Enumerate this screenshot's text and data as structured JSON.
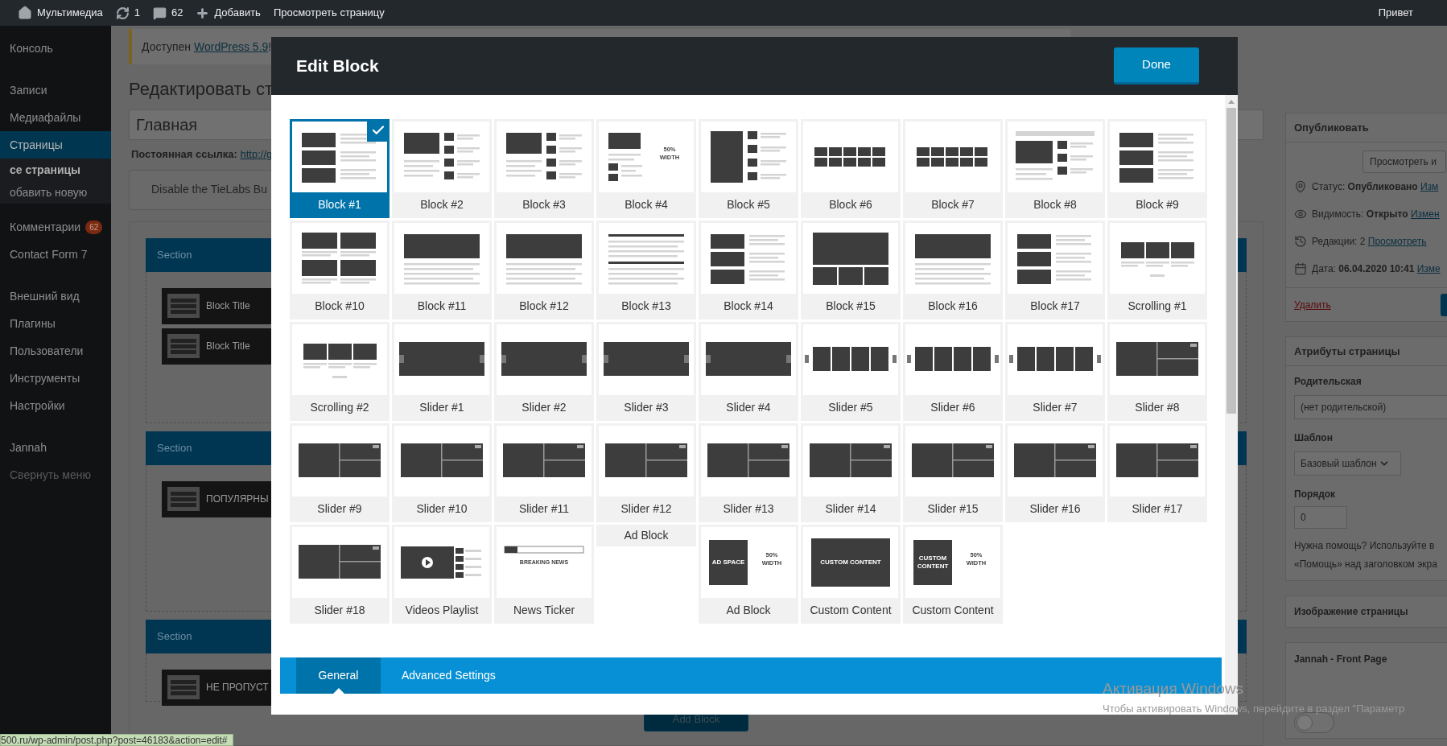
{
  "admin_bar": {
    "site": "Мультимедиа",
    "updates": "1",
    "comments": "62",
    "add": "Добавить",
    "view": "Просмотреть страницу",
    "greeting": "Привет"
  },
  "sidebar": {
    "items": [
      {
        "label": "Консоль",
        "selected": false,
        "kind": "item"
      },
      {
        "label": "Записи",
        "selected": false,
        "kind": "item"
      },
      {
        "label": "Медиафайлы",
        "selected": false,
        "kind": "item"
      },
      {
        "label": "Страницы",
        "selected": true,
        "kind": "item"
      },
      {
        "label": "се страницы",
        "selected": true,
        "kind": "sub"
      },
      {
        "label": "обавить новую",
        "selected": false,
        "kind": "sub"
      },
      {
        "label": "Комментарии",
        "selected": false,
        "kind": "item",
        "badge": "62"
      },
      {
        "label": "Contact Form 7",
        "selected": false,
        "kind": "item"
      },
      {
        "label": "Внешний вид",
        "selected": false,
        "kind": "item"
      },
      {
        "label": "Плагины",
        "selected": false,
        "kind": "item"
      },
      {
        "label": "Пользователи",
        "selected": false,
        "kind": "item"
      },
      {
        "label": "Инструменты",
        "selected": false,
        "kind": "item"
      },
      {
        "label": "Настройки",
        "selected": false,
        "kind": "item"
      },
      {
        "label": "Jannah",
        "selected": false,
        "kind": "item"
      },
      {
        "label": "Свернуть меню",
        "selected": false,
        "kind": "collapse"
      }
    ]
  },
  "notice": {
    "text": "Доступен ",
    "link": "WordPress 5.9",
    "end": "!"
  },
  "heading": "Редактировать ст",
  "title_field": {
    "value": "Главная"
  },
  "permalink": {
    "label": "Постоянная ссылка: ",
    "link": "http://g"
  },
  "builder_toggle": "Disable the TieLabs Bu",
  "sections": [
    {
      "title": "Section",
      "blocks": [
        "Block Title",
        "Block Title"
      ]
    },
    {
      "title": "Section",
      "blocks": [
        "ПОПУЛЯРНЫ"
      ]
    },
    {
      "title": "Section",
      "blocks": [
        "НЕ ПРОПУСТ"
      ]
    }
  ],
  "add_block": "Add Block",
  "modal": {
    "title": "Edit Block",
    "done": "Done",
    "tiles": [
      {
        "label": "Block #1",
        "selected": true,
        "kind": "rows"
      },
      {
        "label": "Block #2",
        "selected": false,
        "kind": "feature"
      },
      {
        "label": "Block #3",
        "selected": false,
        "kind": "feature"
      },
      {
        "label": "Block #4",
        "selected": false,
        "kind": "half",
        "side_text": [
          "50%",
          "WIDTH"
        ]
      },
      {
        "label": "Block #5",
        "selected": false,
        "kind": "tall"
      },
      {
        "label": "Block #6",
        "selected": false,
        "kind": "grid"
      },
      {
        "label": "Block #7",
        "selected": false,
        "kind": "grid"
      },
      {
        "label": "Block #8",
        "selected": false,
        "kind": "tabs"
      },
      {
        "label": "Block #9",
        "selected": false,
        "kind": "rows"
      },
      {
        "label": "Block #10",
        "selected": false,
        "kind": "two"
      },
      {
        "label": "Block #11",
        "selected": false,
        "kind": "wide"
      },
      {
        "label": "Block #12",
        "selected": false,
        "kind": "wide"
      },
      {
        "label": "Block #13",
        "selected": false,
        "kind": "lines"
      },
      {
        "label": "Block #14",
        "selected": false,
        "kind": "rows"
      },
      {
        "label": "Block #15",
        "selected": false,
        "kind": "big3"
      },
      {
        "label": "Block #16",
        "selected": false,
        "kind": "wide"
      },
      {
        "label": "Block #17",
        "selected": false,
        "kind": "rows"
      },
      {
        "label": "Scrolling #1",
        "selected": false,
        "kind": "scroll"
      },
      {
        "label": "Scrolling #2",
        "selected": false,
        "kind": "scroll"
      },
      {
        "label": "Slider #1",
        "selected": false,
        "kind": "slider"
      },
      {
        "label": "Slider #2",
        "selected": false,
        "kind": "slider"
      },
      {
        "label": "Slider #3",
        "selected": false,
        "kind": "slider"
      },
      {
        "label": "Slider #4",
        "selected": false,
        "kind": "slider"
      },
      {
        "label": "Slider #5",
        "selected": false,
        "kind": "carousel"
      },
      {
        "label": "Slider #6",
        "selected": false,
        "kind": "carousel"
      },
      {
        "label": "Slider #7",
        "selected": false,
        "kind": "carousel"
      },
      {
        "label": "Slider #8",
        "selected": false,
        "kind": "mosaic"
      },
      {
        "label": "Slider #9",
        "selected": false,
        "kind": "mosaic"
      },
      {
        "label": "Slider #10",
        "selected": false,
        "kind": "mosaic"
      },
      {
        "label": "Slider #11",
        "selected": false,
        "kind": "mosaic"
      },
      {
        "label": "Slider #12",
        "selected": false,
        "kind": "mosaic"
      },
      {
        "label": "Slider #13",
        "selected": false,
        "kind": "mosaic"
      },
      {
        "label": "Slider #14",
        "selected": false,
        "kind": "mosaic"
      },
      {
        "label": "Slider #15",
        "selected": false,
        "kind": "mosaic"
      },
      {
        "label": "Slider #16",
        "selected": false,
        "kind": "mosaic"
      },
      {
        "label": "Slider #17",
        "selected": false,
        "kind": "mosaic"
      },
      {
        "label": "Slider #18",
        "selected": false,
        "kind": "mosaic"
      },
      {
        "label": "Videos Playlist",
        "selected": false,
        "kind": "video"
      },
      {
        "label": "News Ticker",
        "selected": false,
        "kind": "ticker",
        "side_text": [
          "BREAKING NEWS"
        ]
      },
      {
        "label": "Ad Block",
        "selected": false,
        "kind": "label"
      },
      {
        "label": "Ad Block",
        "selected": false,
        "kind": "ad",
        "box_text": [
          "AD SPACE"
        ],
        "side_text": [
          "50%",
          "WIDTH"
        ]
      },
      {
        "label": "Custom Content",
        "selected": false,
        "kind": "custom",
        "box_text": [
          "CUSTOM CONTENT"
        ]
      },
      {
        "label": "Custom Content",
        "selected": false,
        "kind": "ad",
        "box_text": [
          "CUSTOM",
          "CONTENT"
        ],
        "side_text": [
          "50%",
          "WIDTH"
        ]
      }
    ],
    "tabs": [
      {
        "label": "General",
        "selected": true
      },
      {
        "label": "Advanced Settings",
        "selected": false
      }
    ]
  },
  "publish": {
    "title": "Опубликовать",
    "preview": "Просмотреть и",
    "rows": [
      {
        "kind": "status",
        "label": "Статус: ",
        "value": "Опубликовано",
        "link": "Изм"
      },
      {
        "kind": "visibility",
        "label": "Видимость: ",
        "value": "Открыто",
        "link": "Измен"
      },
      {
        "kind": "revisions",
        "label": "Редакции: 2 ",
        "value": "",
        "link": "Просмотреть"
      },
      {
        "kind": "date",
        "label": "Дата: ",
        "value": "06.04.2020 10:41",
        "link": "Изме"
      }
    ],
    "delete": "Удалить"
  },
  "attributes": {
    "title": "Атрибуты страницы",
    "parent_label": "Родительская",
    "parent": "(нет родительской)",
    "template_label": "Шаблон",
    "template": "Базовый шаблон",
    "order_label": "Порядок",
    "order": "0",
    "help": [
      "Нужна помощь? Используйте в",
      "«Помощь» над заголовком экра"
    ]
  },
  "featured_image": {
    "title": "Изображение страницы"
  },
  "front_page": {
    "title": "Jannah - Front Page",
    "on": false
  },
  "status_url": "500.ru/wp-admin/post.php?post=46183&action=edit#",
  "os_notice": [
    "Активация Windows",
    "Чтобы активировать Windows, перейдите в раздел \"Параметр"
  ]
}
